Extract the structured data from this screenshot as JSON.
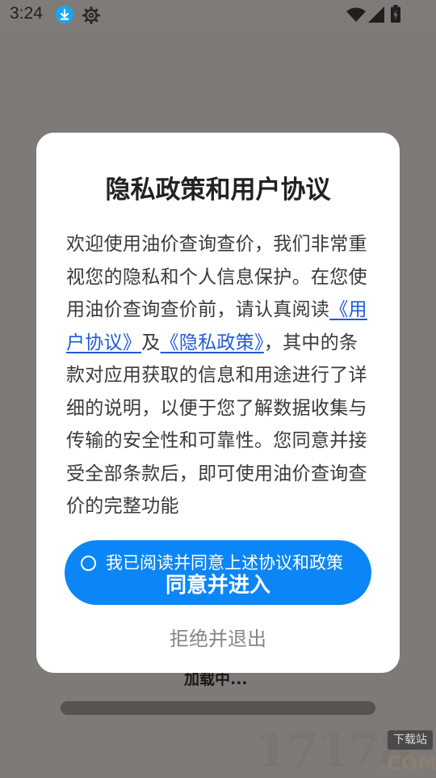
{
  "status_bar": {
    "time": "3:24",
    "icons": [
      "download-icon",
      "gear-icon",
      "wifi-icon",
      "signal-icon",
      "battery-icon"
    ]
  },
  "background": {
    "loading_text": "加载中...",
    "watermark": {
      "number": "17178",
      "domain": ".COM",
      "badge": "下载站"
    }
  },
  "dialog": {
    "title": "隐私政策和用户协议",
    "body": {
      "intro": "欢迎使用油价查询查价，我们非常重视您的隐私和个人信息保护。在您使用油价查询查价前，请认真阅读",
      "link_user_agreement": "《用户协议》",
      "and": "及",
      "link_privacy_policy": "《隐私政策》",
      "rest": "，其中的条款对应用获取的信息和用途进行了详细的说明，以便于您了解数据收集与传输的安全性和可靠性。您同意并接受全部条款后，即可使用油价查询查价的完整功能"
    },
    "agree_checkbox_label": "我已阅读并同意上述协议和政策",
    "agree_button_label": "同意并进入",
    "reject_button_label": "拒绝并退出"
  },
  "colors": {
    "accent": "#0c86f6",
    "link": "#1e5bd6",
    "overlay": "#7e7a78"
  }
}
